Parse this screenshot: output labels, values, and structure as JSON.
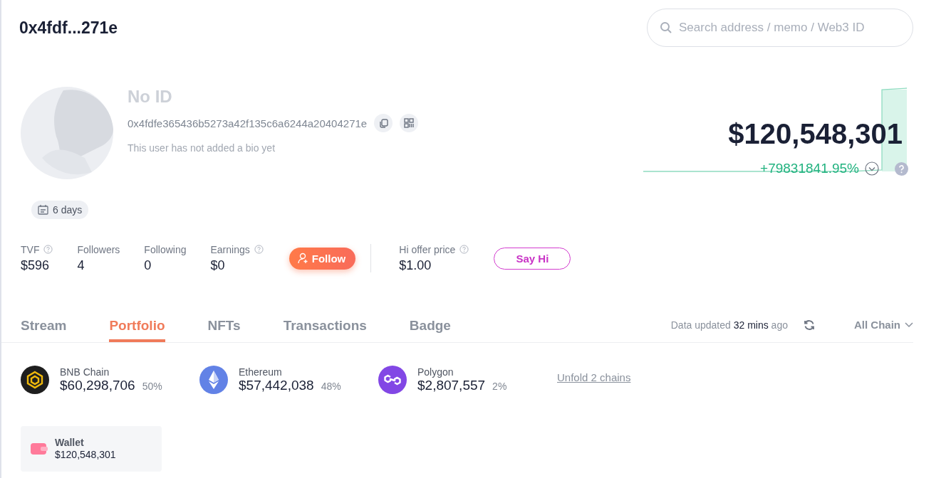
{
  "header": {
    "title": "0x4fdf...271e",
    "search": {
      "placeholder": "Search address / memo / Web3 ID"
    }
  },
  "profile": {
    "name": "No ID",
    "address": "0x4fdfe365436b5273a42f135c6a6244a20404271e",
    "bio": "This user has not added a bio yet",
    "age": "6 days"
  },
  "balance": {
    "total": "$120,548,301",
    "change": "+79831841.95%"
  },
  "stats": [
    {
      "label": "TVF",
      "value": "$596",
      "help": true
    },
    {
      "label": "Followers",
      "value": "4",
      "help": false
    },
    {
      "label": "Following",
      "value": "0",
      "help": false
    },
    {
      "label": "Earnings",
      "value": "$0",
      "help": true
    }
  ],
  "follow_button": "Follow",
  "offer": {
    "label": "Hi offer price",
    "value": "$1.00",
    "button": "Say Hi"
  },
  "tabs": [
    {
      "label": "Stream",
      "selected": false
    },
    {
      "label": "Portfolio",
      "selected": true
    },
    {
      "label": "NFTs",
      "selected": false
    },
    {
      "label": "Transactions",
      "selected": false
    },
    {
      "label": "Badge",
      "selected": false
    }
  ],
  "updated": "Data updated **32 mins** ago",
  "chain_filter": "All Chain",
  "chains": [
    {
      "kind": "bnb",
      "name": "BNB Chain",
      "value": "$60,298,706",
      "share": "50%"
    },
    {
      "kind": "ethereum",
      "name": "Ethereum",
      "value": "$57,442,038",
      "share": "48%"
    },
    {
      "kind": "polygon",
      "name": "Polygon",
      "value": "$2,807,557",
      "share": "2%"
    }
  ],
  "unfold_link": "Unfold 2 chains",
  "wallet": {
    "label": "Wallet",
    "value": "$120,548,301"
  }
}
